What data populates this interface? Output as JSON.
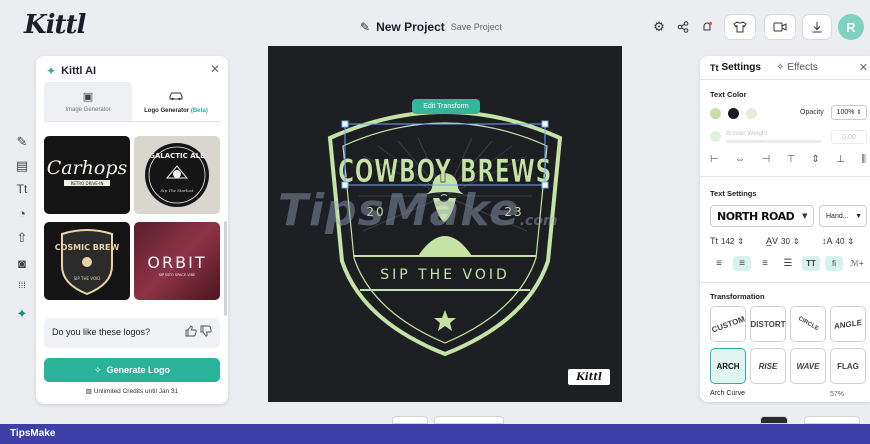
{
  "app": {
    "logo": "Kittl"
  },
  "header": {
    "project_name": "New Project",
    "save_label": "Save Project",
    "avatar_initial": "R",
    "icons": [
      "gear-icon",
      "share-icon",
      "notifications-icon",
      "shirt-icon",
      "present-icon",
      "download-icon"
    ]
  },
  "ai_panel": {
    "title": "Kittl AI",
    "tabs": [
      {
        "label": "Image Generator",
        "icon": "image-icon"
      },
      {
        "label": "Logo Generator",
        "badge": "(Beta)",
        "icon": "car-icon"
      }
    ],
    "gallery": [
      {
        "title": "Carhops",
        "subtitle": "RETRO DRIVE-IN"
      },
      {
        "title": "GALACTIC ALE",
        "subtitle": "Sip The Starlust"
      },
      {
        "title": "COSMIC BREW",
        "subtitle": "SIP THE VOID"
      },
      {
        "title": "ORBIT",
        "subtitle": "SIP INTO SPACE VIBE"
      }
    ],
    "feedback_question": "Do you like these logos?",
    "generate_label": "Generate Logo",
    "credits_text": "Unlimited Credits until Jan 31"
  },
  "canvas": {
    "edit_label": "Edit Transform",
    "design": {
      "headline": "COWBOY BREWS",
      "year_left": "20",
      "year_right": "23",
      "tagline": "SIP THE VOID"
    },
    "watermark": "TipsMake",
    "watermark_suffix": ".com",
    "brand_mark": "Kittl"
  },
  "right_panel": {
    "tabs": [
      {
        "label": "Settings",
        "icon": "text-icon"
      },
      {
        "label": "Effects",
        "icon": "sparkle-icon"
      }
    ],
    "text_color": {
      "heading": "Text Color",
      "swatches": [
        "#c3e1a3",
        "#1b1c22",
        "#e8ecd9"
      ],
      "opacity_label": "Opacity",
      "opacity_value": "100%",
      "border_label": "Border Weight",
      "border_value": "0.00"
    },
    "text_settings": {
      "heading": "Text Settings",
      "font": "NORTH ROAD",
      "style": "Hand...",
      "size": "142",
      "letter_spacing": "30",
      "line_height": "40"
    },
    "transformation": {
      "heading": "Transformation",
      "options": [
        "CUSTOM",
        "DISTORT",
        "CIRCLE",
        "ANGLE",
        "ARCH",
        "RISE",
        "WAVE",
        "FLAG"
      ],
      "selected": "ARCH",
      "arch_label": "Arch Curve",
      "arch_value": "57%"
    }
  },
  "footer": {
    "text": "TipsMake"
  }
}
